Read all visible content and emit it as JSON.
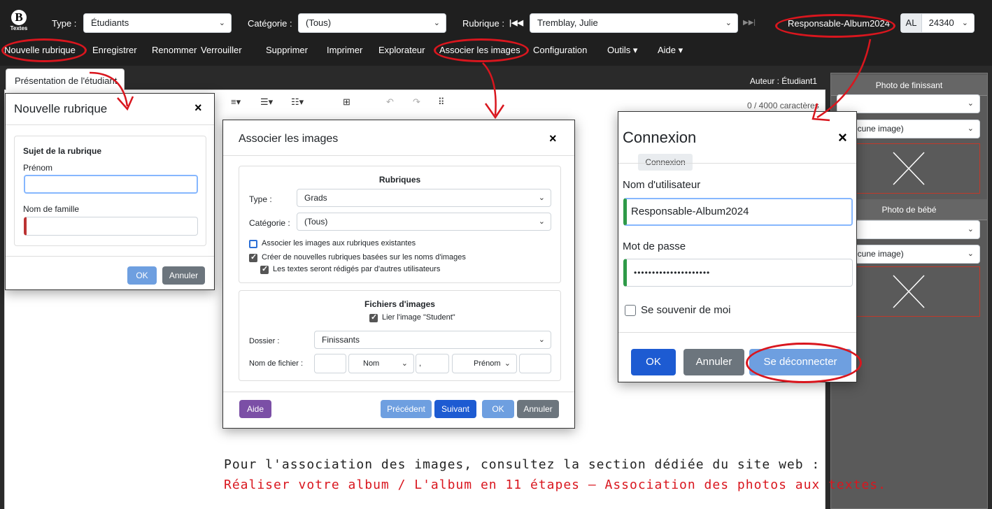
{
  "app": {
    "logo_letter": "B",
    "logo_caption": "Textes"
  },
  "toolbar": {
    "type_label": "Type :",
    "type_value": "Étudiants",
    "category_label": "Catégorie :",
    "category_value": "(Tous)",
    "rubric_label": "Rubrique :",
    "rubric_first_icon": "|◀◀",
    "rubric_value": "Tremblay, Julie",
    "rubric_last_icon": "▶▶|",
    "user_button": "Responsable-Album2024",
    "album_prefix": "AL",
    "album_code": "24340"
  },
  "menu": [
    "Nouvelle rubrique",
    "Enregistrer",
    "Renommer",
    "Verrouiller",
    "Supprimer",
    "Imprimer",
    "Explorateur",
    "Associer les images",
    "Configuration",
    "Outils ▾",
    "Aide ▾"
  ],
  "tab_label": "Présentation de l'étudiant",
  "author": "Auteur : Étudiant1",
  "editor": {
    "char_count": "0 / 4000 caractères",
    "tools": [
      "≡▾",
      "☰▾",
      "☷▾",
      "⊞",
      "↶",
      "↷",
      "⠿"
    ]
  },
  "right_panel": {
    "sections": [
      {
        "title": "Photo de finissant",
        "select1": "",
        "select2": "(Aucune image)"
      },
      {
        "title": "Photo de bébé",
        "select1": "",
        "select2": "(Aucune image)"
      }
    ]
  },
  "new_rubric_dialog": {
    "title": "Nouvelle rubrique",
    "close": "×",
    "section_title": "Sujet de la rubrique",
    "first_name_label": "Prénom",
    "first_name_value": "",
    "last_name_label": "Nom de famille",
    "last_name_value": "",
    "ok": "OK",
    "cancel": "Annuler"
  },
  "associate_dialog": {
    "title": "Associer les images",
    "close": "×",
    "rubrics_title": "Rubriques",
    "type_label": "Type :",
    "type_value": "Grads",
    "category_label": "Catégorie :",
    "category_value": "(Tous)",
    "opt1": "Associer les images aux rubriques existantes",
    "opt1_checked": false,
    "opt2": "Créer de nouvelles rubriques basées sur les noms d'images",
    "opt2_checked": true,
    "opt3": "Les textes seront rédigés par d'autres utilisateurs",
    "opt3_checked": true,
    "files_title": "Fichiers d'images",
    "link_label": "Lier l'image \"Student\"",
    "link_checked": true,
    "folder_label": "Dossier :",
    "folder_value": "Finissants",
    "filename_label": "Nom de fichier :",
    "fn_part1": "",
    "fn_sel1": "Nom",
    "fn_sep": ",",
    "fn_sel2": "Prénom",
    "fn_part3": "",
    "help": "Aide",
    "prev": "Précédent",
    "next": "Suivant",
    "ok": "OK",
    "cancel": "Annuler"
  },
  "login_dialog": {
    "title": "Connexion",
    "close": "×",
    "tab": "Connexion",
    "username_label": "Nom d'utilisateur",
    "username_value": "Responsable-Album2024",
    "password_label": "Mot de passe",
    "password_value": "•••••••••••••••••••••",
    "remember_label": "Se souvenir de moi",
    "ok": "OK",
    "cancel": "Annuler",
    "logout": "Se déconnecter"
  },
  "note": {
    "line1": "Pour l'association des images, consultez la section dédiée du site web :",
    "line2": "Réaliser votre album / L'album en 11 étapes – Association des photos aux textes."
  },
  "colors": {
    "annotation_red": "#d9161e",
    "primary": "#0d6efd",
    "secondary": "#6c757d",
    "purple": "#7b4fa6",
    "dark": "#1f1f1f"
  }
}
